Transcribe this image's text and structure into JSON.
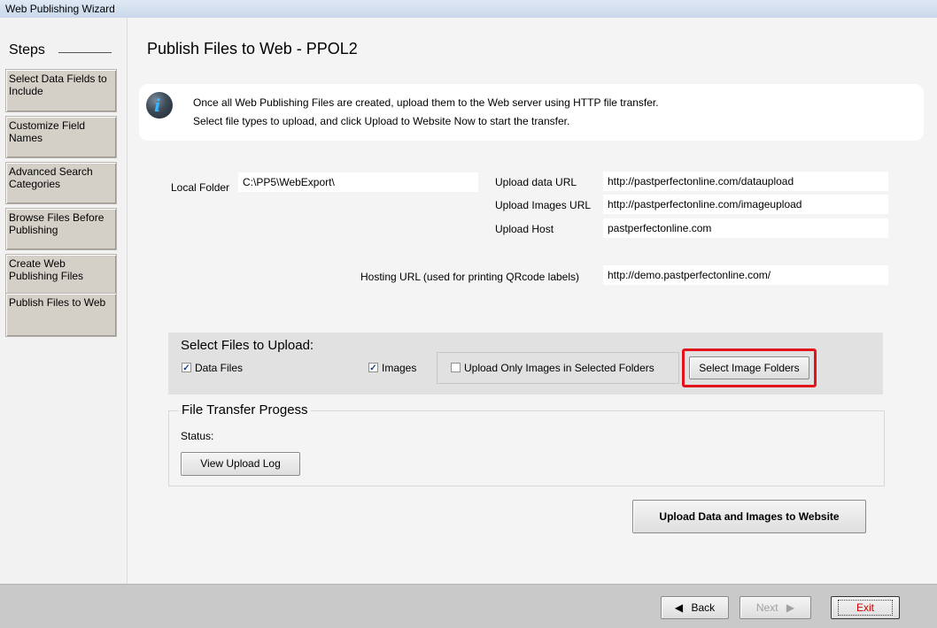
{
  "window": {
    "title": "Web Publishing Wizard"
  },
  "sidebar": {
    "title": "Steps",
    "items": [
      {
        "label": "Select Data Fields to Include"
      },
      {
        "label": "Customize Field Names"
      },
      {
        "label": "Advanced Search Categories"
      },
      {
        "label": "Browse Files Before Publishing"
      },
      {
        "label": "Create Web Publishing Files"
      },
      {
        "label": "Publish Files to Web"
      }
    ]
  },
  "main": {
    "title": "Publish Files to Web - PPOL2",
    "info": {
      "icon": "info-icon",
      "line1": "Once all Web Publishing Files are created, upload them to the Web server using HTTP file transfer.",
      "line2": "Select file types to upload, and click Upload to Website Now to start the transfer."
    },
    "fields": {
      "local_folder_label": "Local Folder",
      "local_folder_value": "C:\\PP5\\WebExport\\",
      "upload_data_url_label": "Upload data URL",
      "upload_data_url_value": "http://pastperfectonline.com/dataupload",
      "upload_images_url_label": "Upload Images URL",
      "upload_images_url_value": "http://pastperfectonline.com/imageupload",
      "upload_host_label": "Upload Host",
      "upload_host_value": "pastperfectonline.com",
      "hosting_url_label": "Hosting URL (used for printing QRcode labels)",
      "hosting_url_value": "http://demo.pastperfectonline.com/"
    },
    "upload_group": {
      "title": "Select Files to Upload:",
      "data_files_label": "Data Files",
      "data_files_checked": true,
      "images_label": "Images",
      "images_checked": true,
      "only_selected_label": "Upload Only Images in Selected Folders",
      "only_selected_checked": false,
      "select_folders_button": "Select Image Folders"
    },
    "transfer_group": {
      "title": "File Transfer Progess",
      "status_label": "Status:",
      "view_log_button": "View Upload Log"
    },
    "upload_button": "Upload Data and Images to Website"
  },
  "footer": {
    "back_label": "Back",
    "next_label": "Next",
    "exit_label": "Exit",
    "exit_color": "#cc0000"
  }
}
